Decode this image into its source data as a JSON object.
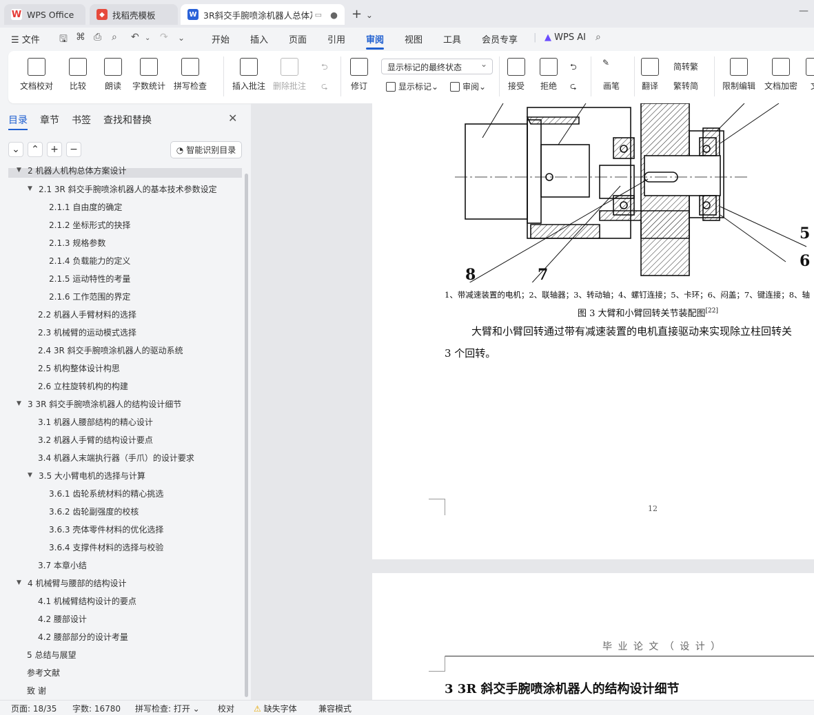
{
  "tabs": [
    {
      "label": "WPS Office",
      "icon": "wps-logo"
    },
    {
      "label": "找稻壳模板",
      "icon": "docer-icon"
    },
    {
      "label": "3R斜交手腕喷涂机器人总体及",
      "icon": "writer-w-icon"
    }
  ],
  "menu": {
    "file": "文件",
    "items": [
      "开始",
      "插入",
      "页面",
      "引用",
      "审阅",
      "视图",
      "工具",
      "会员专享"
    ],
    "active": "审阅",
    "ai": "WPS AI"
  },
  "ribbon": {
    "buttons": [
      "文档校对",
      "比较",
      "朗读",
      "字数统计",
      "拼写检查",
      "插入批注",
      "删除批注",
      "修订",
      "接受",
      "拒绝",
      "画笔",
      "翻译",
      "限制编辑",
      "文档加密",
      "文"
    ],
    "markup_dropdown": "显示标记的最终状态",
    "show_markup": "显示标记",
    "review": "审阅",
    "to_traditional": "转繁",
    "to_simplified": "转简"
  },
  "sidebar": {
    "tabs": [
      "目录",
      "章节",
      "书签",
      "查找和替换"
    ],
    "smart_btn": "智能识别目录",
    "toc": [
      "2  机器人机构总体方案设计",
      "2.1 3R 斜交手腕喷涂机器人的基本技术参数设定",
      "2.1.1  自由度的确定",
      "2.1.2  坐标形式的抉择",
      "2.1.3 规格参数",
      "2.1.4  负载能力的定义",
      "2.1.5  运动特性的考量",
      "2.1.6  工作范围的界定",
      "2.2  机器人手臂材料的选择",
      "2.3  机械臂的运动模式选择",
      "2.4 3R 斜交手腕喷涂机器人的驱动系统",
      "2.5  机构整体设计构思",
      "2.6  立柱旋转机构的构建",
      "3  3R 斜交手腕喷涂机器人的结构设计细节",
      "3.1  机器人腰部结构的精心设计",
      "3.2  机器人手臂的结构设计要点",
      "3.4  机器人末端执行器（手爪）的设计要求",
      "3.5  大小臂电机的选择与计算",
      "3.6.1  齿轮系统材料的精心挑选",
      "3.6.2  齿轮副强度的校核",
      "3.6.3  壳体零件材料的优化选择",
      "3.6.4  支撑件材料的选择与校验",
      "3.7 本章小结",
      "4  机械臂与腰部的结构设计",
      "4.1  机械臂结构设计的要点",
      "4.2  腰部设计",
      "4.2  腰部部分的设计考量",
      "5  总结与展望",
      "参考文献",
      "致  谢"
    ]
  },
  "document": {
    "labels": [
      "5",
      "6",
      "7",
      "8"
    ],
    "legend": "1、带减速装置的电机；2、联轴器；3、转动轴；4、螺钉连接；5、卡环；6、闷盖；7、键连接；8、轴",
    "caption": "图 3  大臂和小臂回转关节装配图",
    "caption_ref": "[22]",
    "para_line1": "大臂和小臂回转通过带有减速装置的电机直接驱动来实现除立柱回转关",
    "para_line2": "3 个回转。",
    "page_number": "12",
    "header2": "毕 业 论 文 （ 设 计 ）",
    "heading2": "3 3R 斜交手腕喷涂机器人的结构设计细节"
  },
  "status": {
    "page": "页面: 18/35",
    "words": "字数: 16780",
    "spell": "拼写检查: 打开",
    "proof": "校对",
    "missing_font": "缺失字体",
    "compat": "兼容模式"
  }
}
